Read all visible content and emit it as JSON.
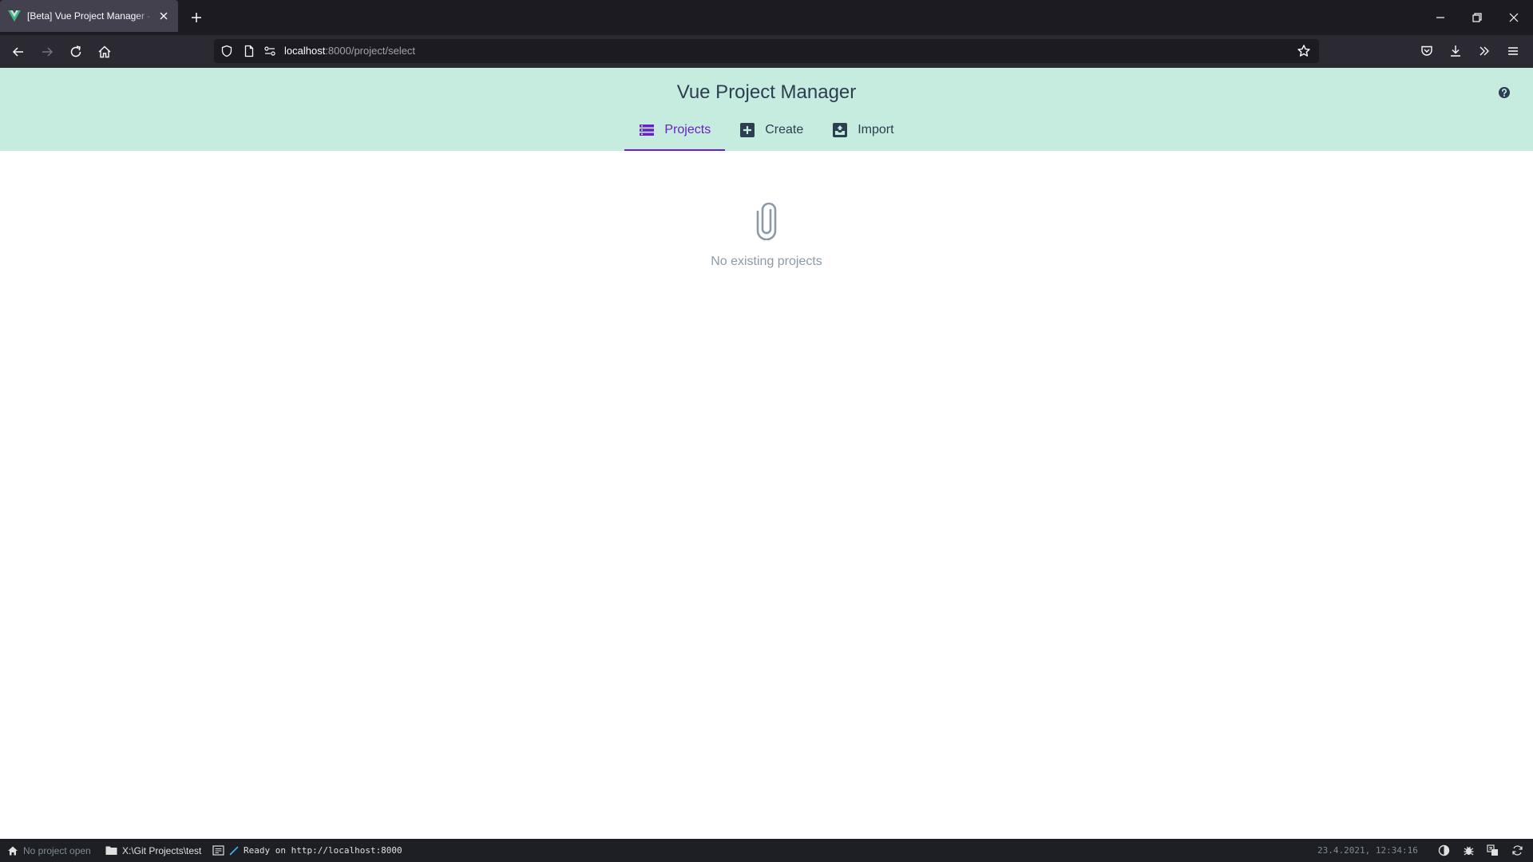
{
  "browser": {
    "tab_title": "[Beta] Vue Project Manager - Vue CLI",
    "url_host": "localhost",
    "url_rest": ":8000/project/select"
  },
  "app": {
    "title": "Vue Project Manager",
    "accent_color": "#6a1fc9",
    "header_color": "#c6ebdf",
    "tabs": [
      {
        "label": "Projects",
        "icon": "list-icon",
        "active": true
      },
      {
        "label": "Create",
        "icon": "plus-box-icon",
        "active": false
      },
      {
        "label": "Import",
        "icon": "import-box-icon",
        "active": false
      }
    ]
  },
  "empty_state": {
    "icon": "paperclip-icon",
    "message": "No existing projects"
  },
  "statusbar": {
    "project": "No project open",
    "folder": "X:\\Git Projects\\test",
    "log": "Ready on http://localhost:8000",
    "datetime": "23.4.2021, 12:34:16"
  }
}
